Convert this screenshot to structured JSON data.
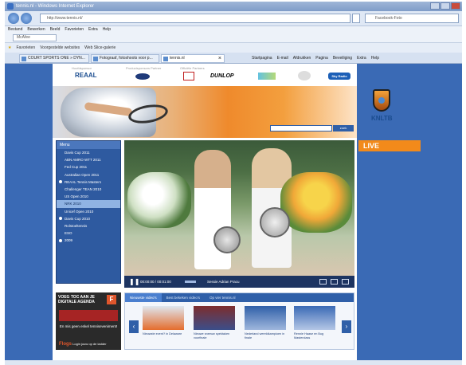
{
  "window": {
    "title": "tennis.nl - Windows Internet Explorer"
  },
  "address": {
    "url": "http://www.tennis.nl/",
    "search_placeholder": "Facebook-Foto"
  },
  "menu_bar": [
    "Bestand",
    "Bewerken",
    "Beeld",
    "Favorieten",
    "Extra",
    "Help"
  ],
  "small_field": "McAfee",
  "favorites": {
    "label": "Favorieten",
    "items": [
      "Voorgestelde websites",
      "Web Slice-galerie"
    ]
  },
  "tabs": [
    {
      "label": "COURT SPORTS ONE » DYN..."
    },
    {
      "label": "Fotograaf, fotoshoots voor p..."
    },
    {
      "label": "tennis.nl"
    }
  ],
  "toolbar_right": [
    "Startpagina",
    "E-mail",
    "Afdrukken",
    "Pagina",
    "Beveiliging",
    "Extra",
    "Help"
  ],
  "sponsors": {
    "labels": [
      "Hoofdsponsor",
      "Productsponsors Partner",
      "Officiële Partners"
    ],
    "logos": [
      "REAAL",
      "DUNLOP",
      "Sky Radio"
    ]
  },
  "site_search": {
    "button": "zoek"
  },
  "brand": {
    "knltb": "KNLTB",
    "live": "LIVE"
  },
  "sidebar_menu": {
    "title": "Menu",
    "items": [
      {
        "label": "Davis Cup 2011",
        "bullet": false,
        "active": false
      },
      {
        "label": "ABN AMRO WTT 2011",
        "bullet": false,
        "active": false
      },
      {
        "label": "Fed Cup 2011",
        "bullet": false,
        "active": false
      },
      {
        "label": "Australian Open 2011",
        "bullet": false,
        "active": false
      },
      {
        "label": "REAAL Tennis Masters",
        "bullet": true,
        "active": false
      },
      {
        "label": "Challenger TEAN 2010",
        "bullet": false,
        "active": false
      },
      {
        "label": "US Open 2010",
        "bullet": false,
        "active": false
      },
      {
        "label": "NRK 2010",
        "bullet": false,
        "active": true
      },
      {
        "label": "Unicef Open 2010",
        "bullet": false,
        "active": false
      },
      {
        "label": "Davis Cup 2010",
        "bullet": true,
        "active": false
      },
      {
        "label": "Rolstoeltennis",
        "bullet": false,
        "active": false
      },
      {
        "label": "ESO",
        "bullet": false,
        "active": false
      },
      {
        "label": "2009",
        "bullet": true,
        "active": false
      }
    ]
  },
  "player": {
    "time": "00:00:00 / 00:01:00",
    "title": "Sessie Adrian Pracu"
  },
  "agenda": {
    "heading": "VOEG TOC AAN JE DIGITALE AGENDA",
    "icon": "F",
    "subtext": "En mis geen enkel tenniseveniment!",
    "flogs_brand": "Flogs",
    "flogs_text": "Login jouw op de ladder"
  },
  "video_tabs": [
    "Nieuwste video's",
    "Best bekeken video's",
    "Op vier tennis.nl"
  ],
  "video_thumbs": [
    {
      "title": "Nieuwste event? in Delaware"
    },
    {
      "title": "Nieuwe sneeuw spektaken voorfinale"
    },
    {
      "title": "Nederland wereldkampioen in finale"
    },
    {
      "title": "Rennie Haase en Bug Masterclass"
    }
  ]
}
